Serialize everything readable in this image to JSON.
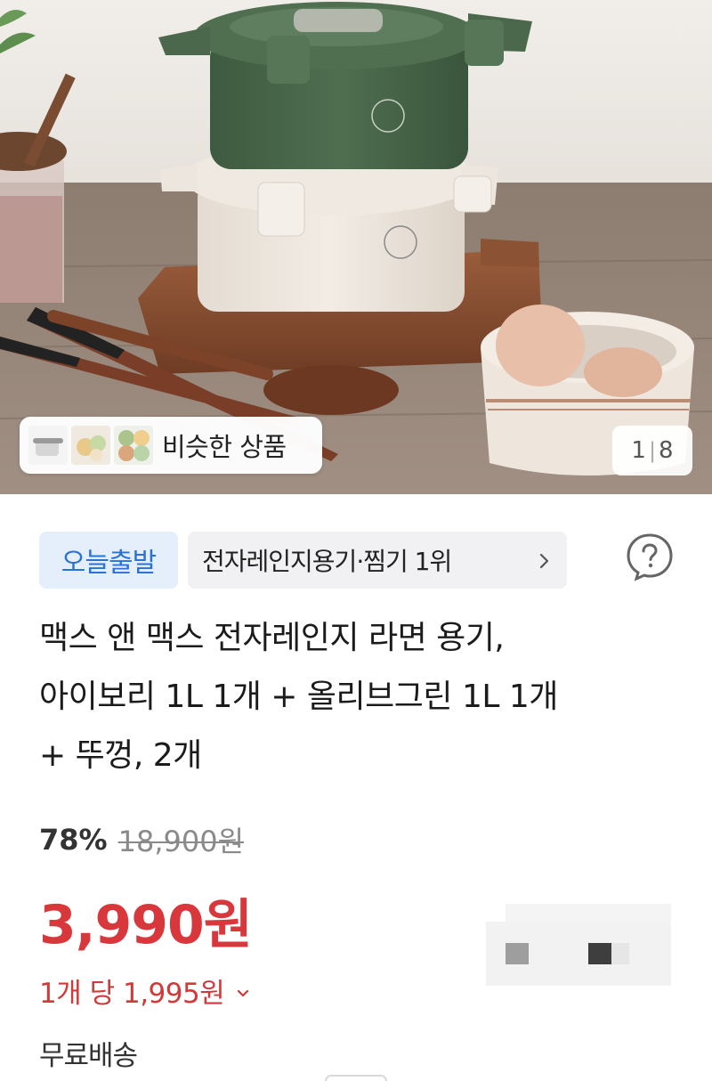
{
  "gallery": {
    "similar_label": "비슷한 상품",
    "current_index": "1",
    "total": "8",
    "thumbnails": [
      "pot-thumbnail",
      "bowls-thumbnail",
      "food-thumbnail"
    ]
  },
  "badges": {
    "departure": "오늘출발",
    "category_rank": "전자레인지용기·찜기 1위"
  },
  "product": {
    "title_line1": "맥스 앤 맥스 전자레인지 라면 용기,",
    "title_line2": "아이보리 1L 1개 + 올리브그린 1L 1개",
    "title_line3": "+ 뚜껑, 2개"
  },
  "price": {
    "discount_rate": "78%",
    "original": "18,900원",
    "sale": "3,990원",
    "unit": "1개 당 1,995원",
    "shipping": "무료배송"
  },
  "colors": {
    "accent_blue": "#2a72d6",
    "badge_blue_bg": "#e5effc",
    "price_red": "#d8383c",
    "unit_red": "#cf3a3a"
  },
  "icons": {
    "help": "question-circle-icon",
    "rank_chevron": "chevron-right-icon",
    "unit_chevron": "chevron-down-icon"
  }
}
